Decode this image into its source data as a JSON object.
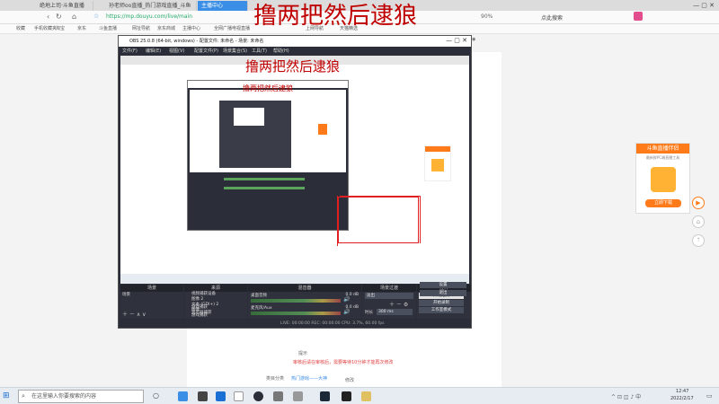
{
  "overlay_title": "撸两把然后逮狼",
  "browser": {
    "tabs": [
      {
        "label": "绝地上司·斗鱼直播"
      },
      {
        "label": "孙老师oo直播_热门游戏直播_斗鱼"
      },
      {
        "label": "主播中心"
      }
    ],
    "url": "https://mp.douyu.com/live/main",
    "zoom": "90%",
    "search_label": "点此搜索",
    "bookmarks": [
      "收藏",
      "手机收藏夹",
      "淘宝",
      "京东",
      "斗鱼直播",
      "网址导航",
      "京东商城",
      "主播中心",
      "全网广播电视直播",
      "上网导航",
      "天猫精选"
    ]
  },
  "obs": {
    "title": "OBS 25.0.8 (64-bit, windows) - 配置文件: 未命名 - 场景: 未命名",
    "menu": [
      "文件(F)",
      "编辑(E)",
      "视图(V)",
      "配置文件(P)",
      "场景集合(S)",
      "工具(T)",
      "帮助(H)"
    ],
    "docks": {
      "scenes_title": "场景",
      "sources_title": "来源",
      "mixer_title": "混音器",
      "transitions_title": "场景过渡",
      "controls_title": "控件"
    },
    "scenes": [
      "场景"
    ],
    "sources": [
      "视频捕获设备",
      "图像 2",
      "文本 (GDI+) 2",
      "图像",
      "游戏捕获",
      "游戏捕获",
      "显示器捕获"
    ],
    "mixer": [
      {
        "name": "桌面音频",
        "level": "0.0 dB"
      },
      {
        "name": "麦克风/Aux",
        "level": "0.0 dB"
      }
    ],
    "transition": {
      "type": "淡出",
      "duration_label": "时长",
      "duration": "300 ms"
    },
    "controls": [
      "开始推流",
      "开始录制",
      "工作室模式",
      "设置",
      "退出"
    ],
    "status": "LIVE: 00:00:00   REC: 00:00:00   CPU: 3.7%, 60.00 fps"
  },
  "inner_obs_title": "撸两把然后逮狼",
  "ad": {
    "title": "斗鱼直播伴侣",
    "subtitle": "最新鲜PC端直播工具",
    "button": "立即下载"
  },
  "page": {
    "notice_title": "提示",
    "notice_text": "审核后请在审核后，需要等待10分钟才能再次修改",
    "category_label": "类目分类",
    "category_value": "热门游戏——大神",
    "edit_label": "修改"
  },
  "taskbar": {
    "search_placeholder": "在这里输入你要搜索的内容",
    "time": "12:47",
    "date": "2022/2/17"
  }
}
